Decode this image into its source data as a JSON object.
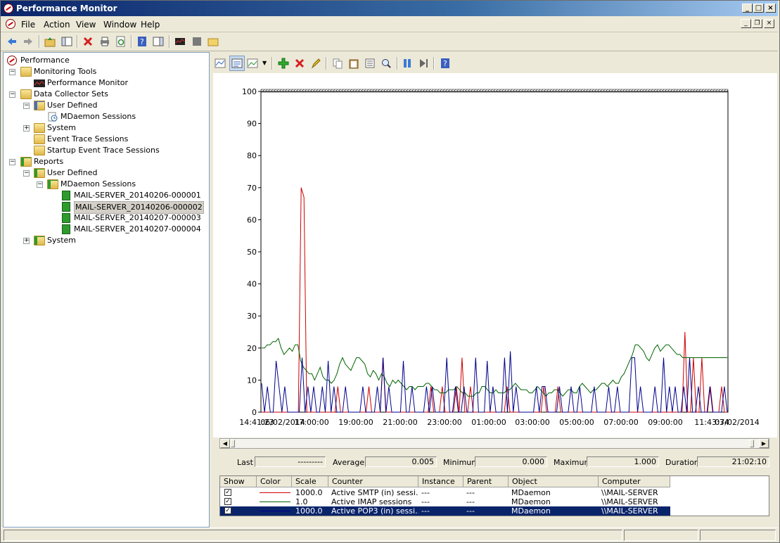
{
  "window": {
    "title": "Performance Monitor"
  },
  "menu": [
    "File",
    "Action",
    "View",
    "Window",
    "Help"
  ],
  "tree": {
    "items": [
      {
        "label": "Performance",
        "level": 0,
        "expander": "",
        "icon": "performance-icon"
      },
      {
        "label": "Monitoring Tools",
        "level": 1,
        "expander": "−",
        "icon": "folder-icon"
      },
      {
        "label": "Performance Monitor",
        "level": 2,
        "expander": "",
        "icon": "perfmon-chart-icon"
      },
      {
        "label": "Data Collector Sets",
        "level": 1,
        "expander": "−",
        "icon": "folder-icon"
      },
      {
        "label": "User Defined",
        "level": 2,
        "expander": "−",
        "icon": "user-folder-icon"
      },
      {
        "label": "MDaemon Sessions",
        "level": 3,
        "expander": "",
        "icon": "collector-set-icon"
      },
      {
        "label": "System",
        "level": 2,
        "expander": "+",
        "icon": "folder-icon"
      },
      {
        "label": "Event Trace Sessions",
        "level": 2,
        "expander": "",
        "icon": "folder-icon"
      },
      {
        "label": "Startup Event Trace Sessions",
        "level": 2,
        "expander": "",
        "icon": "folder-icon"
      },
      {
        "label": "Reports",
        "level": 1,
        "expander": "−",
        "icon": "reports-folder-icon"
      },
      {
        "label": "User Defined",
        "level": 2,
        "expander": "−",
        "icon": "reports-folder-icon"
      },
      {
        "label": "MDaemon Sessions",
        "level": 3,
        "expander": "−",
        "icon": "reports-folder-icon"
      },
      {
        "label": "MAIL-SERVER_20140206-000001",
        "level": 4,
        "expander": "",
        "icon": "report-icon"
      },
      {
        "label": "MAIL-SERVER_20140206-000002",
        "level": 4,
        "expander": "",
        "icon": "report-icon",
        "selected": true
      },
      {
        "label": "MAIL-SERVER_20140207-000003",
        "level": 4,
        "expander": "",
        "icon": "report-icon"
      },
      {
        "label": "MAIL-SERVER_20140207-000004",
        "level": 4,
        "expander": "",
        "icon": "report-icon"
      },
      {
        "label": "System",
        "level": 2,
        "expander": "+",
        "icon": "reports-folder-icon"
      }
    ]
  },
  "stats": {
    "last_label": "Last",
    "last_value": "---------",
    "average_label": "Average",
    "average_value": "0.005",
    "minimum_label": "Minimum",
    "minimum_value": "0.000",
    "maximum_label": "Maximum",
    "maximum_value": "1.000",
    "duration_label": "Duration",
    "duration_value": "21:02:10"
  },
  "legend": {
    "headers": [
      "Show",
      "Color",
      "Scale",
      "Counter",
      "Instance",
      "Parent",
      "Object",
      "Computer"
    ],
    "rows": [
      {
        "show": "✓",
        "color": "#cc0000",
        "scale": "1000.0",
        "counter": "Active SMTP (in) sessi...",
        "instance": "---",
        "parent": "---",
        "object": "MDaemon",
        "computer": "\\\\MAIL-SERVER",
        "selected": false
      },
      {
        "show": "✓",
        "color": "#006400",
        "scale": "1.0",
        "counter": "Active IMAP sessions",
        "instance": "---",
        "parent": "---",
        "object": "MDaemon",
        "computer": "\\\\MAIL-SERVER",
        "selected": false
      },
      {
        "show": "✓",
        "color": "#00008b",
        "scale": "1000.0",
        "counter": "Active POP3 (in) sessi...",
        "instance": "---",
        "parent": "---",
        "object": "MDaemon",
        "computer": "\\\\MAIL-SERVER",
        "selected": true
      }
    ]
  },
  "chart_data": {
    "type": "line",
    "ylim": [
      0,
      100
    ],
    "yticks": [
      "0",
      "10",
      "20",
      "30",
      "40",
      "50",
      "60",
      "70",
      "80",
      "90",
      "100"
    ],
    "xticks": [
      "14:41:23",
      "06/02/2014",
      "17:00:00",
      "19:00:00",
      "21:00:00",
      "23:00:00",
      "01:00:00",
      "03:00:00",
      "05:00:00",
      "07:00:00",
      "09:00:00",
      "11:43:34",
      "07/02/2014"
    ],
    "series": [
      {
        "color": "#cc0000",
        "values": [
          0,
          0,
          0,
          0,
          0,
          0,
          0,
          0,
          0,
          0,
          0,
          0,
          0,
          0,
          70,
          67,
          0,
          0,
          0,
          0,
          0,
          0,
          0,
          0,
          0,
          0,
          0,
          8,
          0,
          0,
          0,
          0,
          0,
          0,
          0,
          0,
          0,
          0,
          8,
          0,
          0,
          0,
          0,
          17,
          0,
          0,
          0,
          0,
          0,
          0,
          0,
          0,
          0,
          0,
          0,
          0,
          0,
          0,
          0,
          0,
          8,
          0,
          0,
          0,
          8,
          0,
          0,
          0,
          0,
          8,
          0,
          17,
          0,
          0,
          8,
          0,
          0,
          0,
          0,
          0,
          0,
          0,
          0,
          0,
          0,
          0,
          0,
          8,
          0,
          0,
          0,
          0,
          0,
          0,
          0,
          0,
          0,
          0,
          0,
          0,
          8,
          0,
          0,
          0,
          0,
          8,
          0,
          0,
          0,
          0,
          0,
          0,
          0,
          0,
          0,
          0,
          0,
          0,
          0,
          0,
          0,
          0,
          0,
          0,
          0,
          0,
          0,
          0,
          0,
          0,
          0,
          0,
          0,
          0,
          0,
          0,
          0,
          0,
          0,
          0,
          0,
          0,
          0,
          0,
          0,
          0,
          0,
          0,
          0,
          0,
          25,
          0,
          0,
          17,
          0,
          0,
          17,
          0,
          0,
          8,
          0,
          0,
          0,
          8,
          0,
          0
        ]
      },
      {
        "color": "#006400",
        "values": [
          20,
          20,
          21,
          21,
          22,
          22,
          23,
          20,
          18,
          19,
          20,
          19,
          21,
          21,
          16,
          14,
          13,
          12,
          12,
          10,
          12,
          14,
          11,
          10,
          10,
          9,
          10,
          12,
          15,
          17,
          15,
          14,
          13,
          15,
          17,
          17,
          16,
          15,
          12,
          11,
          13,
          12,
          10,
          12,
          11,
          9,
          8,
          10,
          9,
          10,
          9,
          8,
          7,
          8,
          8,
          7,
          8,
          8,
          8,
          9,
          9,
          8,
          7,
          7,
          6,
          6,
          6,
          7,
          7,
          7,
          8,
          7,
          6,
          6,
          5,
          5,
          5,
          6,
          6,
          8,
          8,
          7,
          6,
          6,
          7,
          6,
          6,
          6,
          7,
          7,
          8,
          9,
          8,
          7,
          7,
          7,
          6,
          6,
          7,
          8,
          7,
          6,
          5,
          6,
          6,
          7,
          7,
          6,
          5,
          6,
          7,
          7,
          6,
          6,
          8,
          9,
          8,
          7,
          6,
          7,
          7,
          8,
          9,
          9,
          8,
          9,
          10,
          9,
          9,
          11,
          12,
          14,
          16,
          18,
          21,
          21,
          20,
          19,
          17,
          16,
          18,
          20,
          21,
          19,
          20,
          21,
          21,
          20,
          19,
          18,
          18,
          17,
          17,
          17,
          17,
          17,
          17,
          17,
          17,
          17,
          17,
          17,
          17,
          17,
          17,
          17,
          17,
          17
        ]
      },
      {
        "color": "#00008b",
        "values": [
          9,
          0,
          8,
          0,
          0,
          16,
          8,
          0,
          8,
          0,
          0,
          0,
          0,
          0,
          17,
          0,
          8,
          0,
          8,
          0,
          0,
          8,
          0,
          16,
          0,
          8,
          0,
          0,
          0,
          8,
          0,
          0,
          0,
          0,
          0,
          8,
          0,
          0,
          0,
          0,
          8,
          0,
          17,
          0,
          8,
          0,
          0,
          0,
          0,
          16,
          0,
          0,
          8,
          0,
          0,
          0,
          0,
          8,
          0,
          8,
          0,
          0,
          0,
          0,
          17,
          0,
          0,
          8,
          0,
          0,
          8,
          0,
          0,
          0,
          17,
          0,
          0,
          0,
          16,
          0,
          8,
          0,
          0,
          0,
          17,
          0,
          19,
          0,
          8,
          0,
          0,
          0,
          0,
          0,
          0,
          8,
          0,
          8,
          8,
          0,
          0,
          0,
          0,
          8,
          0,
          0,
          0,
          8,
          0,
          0,
          8,
          0,
          0,
          0,
          0,
          8,
          0,
          0,
          0,
          0,
          8,
          0,
          0,
          8,
          0,
          0,
          0,
          0,
          17,
          17,
          0,
          8,
          0,
          0,
          0,
          0,
          8,
          0,
          0,
          17,
          0,
          8,
          0,
          8,
          0,
          0,
          8,
          0,
          17,
          0,
          0,
          8,
          0,
          0,
          0,
          8,
          0,
          0,
          0,
          0,
          8,
          0
        ]
      }
    ]
  }
}
